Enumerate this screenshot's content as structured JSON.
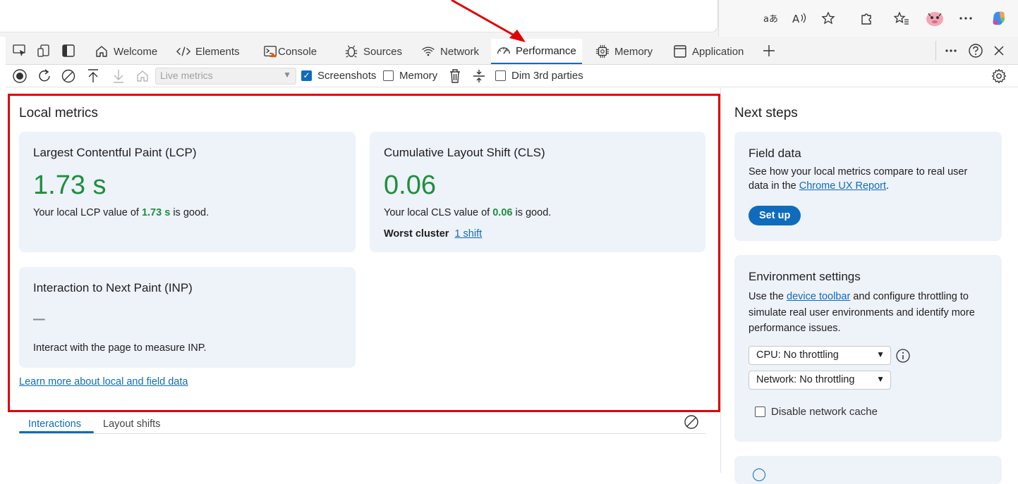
{
  "browser": {
    "icons": [
      "read-aloud-lang-icon",
      "read-aloud-icon",
      "favorite-star-icon",
      "extensions-icon",
      "favorites-icon",
      "profile-avatar",
      "more-icon",
      "copilot-icon"
    ]
  },
  "devtools": {
    "tabs": [
      {
        "label": "Welcome",
        "icon": "home-icon"
      },
      {
        "label": "Elements",
        "icon": "code-icon"
      },
      {
        "label": "Console",
        "icon": "console-icon"
      },
      {
        "label": "Sources",
        "icon": "bug-icon"
      },
      {
        "label": "Network",
        "icon": "wifi-icon"
      },
      {
        "label": "Performance",
        "icon": "gauge-icon",
        "active": true
      },
      {
        "label": "Memory",
        "icon": "chip-icon"
      },
      {
        "label": "Application",
        "icon": "window-icon"
      }
    ]
  },
  "toolbar": {
    "live_select_value": "Live metrics",
    "screenshots_label": "Screenshots",
    "screenshots_checked": true,
    "memory_label": "Memory",
    "memory_checked": false,
    "dim_label": "Dim 3rd parties",
    "dim_checked": false
  },
  "local_metrics": {
    "heading": "Local metrics",
    "lcp": {
      "title": "Largest Contentful Paint (LCP)",
      "value": "1.73 s",
      "desc_prefix": "Your local LCP value of ",
      "desc_value": "1.73 s",
      "desc_suffix": " is good."
    },
    "cls": {
      "title": "Cumulative Layout Shift (CLS)",
      "value": "0.06",
      "desc_prefix": "Your local CLS value of ",
      "desc_value": "0.06",
      "desc_suffix": " is good.",
      "worst_label": "Worst cluster",
      "worst_link": "1 shift"
    },
    "inp": {
      "title": "Interaction to Next Paint (INP)",
      "value": "–",
      "desc": "Interact with the page to measure INP."
    },
    "learn_more": "Learn more about local and field data"
  },
  "bottom_tabs": {
    "interactions": "Interactions",
    "layout_shifts": "Layout shifts"
  },
  "next_steps": {
    "heading": "Next steps",
    "field_data": {
      "title": "Field data",
      "text1": "See how your local metrics compare to real user",
      "text2_prefix": "data in the ",
      "text2_link": "Chrome UX Report",
      "text2_suffix": ".",
      "button": "Set up"
    },
    "environment": {
      "title": "Environment settings",
      "line1_prefix": "Use the ",
      "line1_link": "device toolbar",
      "line1_suffix": " and configure throttling to",
      "line2": "simulate real user environments and identify more",
      "line3": "performance issues.",
      "cpu": "CPU: No throttling",
      "network": "Network: No throttling",
      "cache_label": "Disable network cache"
    }
  },
  "colors": {
    "accent": "#0f6cbd",
    "good": "#1e8e3e",
    "highlight": "#e00000",
    "card_bg": "#eef2f9"
  }
}
